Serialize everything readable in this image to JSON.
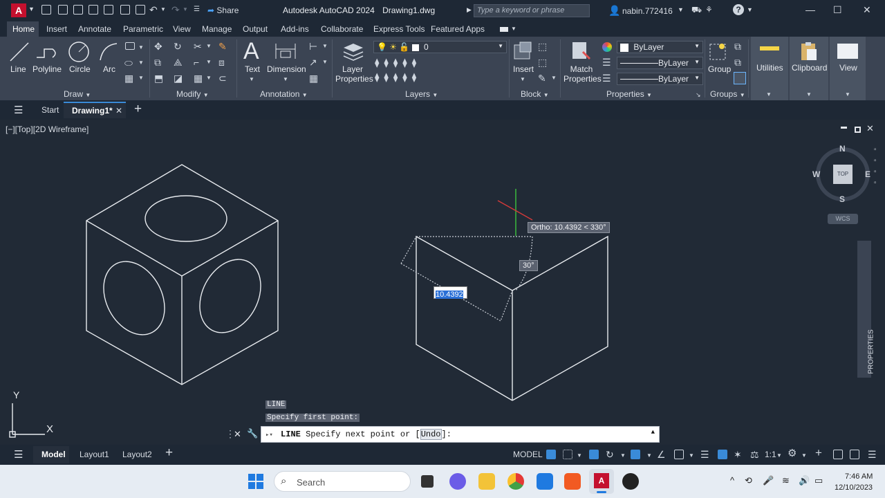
{
  "app": {
    "title": "Autodesk AutoCAD 2024",
    "file": "Drawing1.dwg",
    "share": "Share",
    "search_placeholder": "Type a keyword or phrase",
    "user": "nabin.772416"
  },
  "ribbon_tabs": [
    "Home",
    "Insert",
    "Annotate",
    "Parametric",
    "View",
    "Manage",
    "Output",
    "Add-ins",
    "Collaborate",
    "Express Tools",
    "Featured Apps"
  ],
  "draw_panel": {
    "title": "Draw",
    "line": "Line",
    "polyline": "Polyline",
    "circle": "Circle",
    "arc": "Arc"
  },
  "modify_panel": {
    "title": "Modify"
  },
  "annotation_panel": {
    "title": "Annotation",
    "text": "Text",
    "dimension": "Dimension"
  },
  "layers_panel": {
    "title": "Layers",
    "layer_properties": "Layer Properties",
    "current_layer": "0"
  },
  "block_panel": {
    "title": "Block",
    "insert": "Insert"
  },
  "properties_panel": {
    "title": "Properties",
    "match": "Match Properties",
    "color": "ByLayer",
    "linetype": "ByLayer",
    "lineweight": "ByLayer"
  },
  "groups_panel": {
    "title": "Groups",
    "group": "Group"
  },
  "utilities": "Utilities",
  "clipboard": "Clipboard",
  "view": "View",
  "doc_tabs": {
    "start": "Start",
    "drawing": "Drawing1*"
  },
  "viewport_label": "[−][Top][2D Wireframe]",
  "viewcube": {
    "n": "N",
    "s": "S",
    "e": "E",
    "w": "W",
    "top": "TOP",
    "wcs": "WCS"
  },
  "palette": {
    "properties": "PROPERTIES"
  },
  "ucs": {
    "y": "Y",
    "x": "X"
  },
  "tooltip": {
    "ortho": "Ortho: 10.4392 < 330°",
    "angle": "30°",
    "length": "10.4392"
  },
  "command_history": [
    "LINE",
    "Specify first point:"
  ],
  "command_line": {
    "cmd": "LINE",
    "prompt": "Specify next point or [",
    "option": "Undo",
    "end": "]:"
  },
  "layout_tabs": [
    "Model",
    "Layout1",
    "Layout2"
  ],
  "status": {
    "model": "MODEL",
    "scale": "1:1"
  },
  "taskbar": {
    "search": "Search",
    "time": "7:46 AM",
    "date": "12/10/2023"
  }
}
